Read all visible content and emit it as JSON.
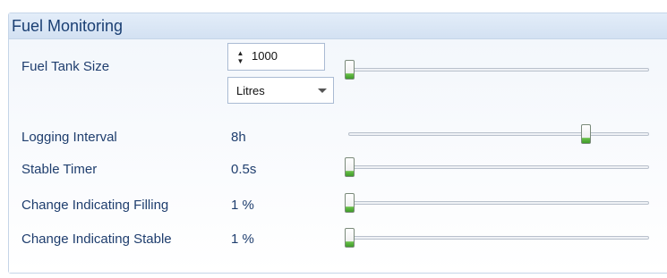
{
  "panel": {
    "title": "Fuel Monitoring"
  },
  "fields": {
    "fuel_tank_size": {
      "label": "Fuel Tank Size",
      "value": "1000",
      "unit": "Litres",
      "slider_fraction": 0.0
    },
    "logging_interval": {
      "label": "Logging Interval",
      "value": "8h",
      "slider_fraction": 0.8
    },
    "stable_timer": {
      "label": "Stable Timer",
      "value": "0.5s",
      "slider_fraction": 0.0
    },
    "change_filling": {
      "label": "Change Indicating Filling",
      "value": "1 %",
      "slider_fraction": 0.0
    },
    "change_stable": {
      "label": "Change Indicating Stable",
      "value": "1 %",
      "slider_fraction": 0.0
    }
  },
  "icons": {
    "spin": "spin-up-down-icon",
    "dropdown": "chevron-down-icon"
  },
  "colors": {
    "label_text": "#1f3e6e",
    "header_text": "#1a3f73",
    "thumb_green": "#4aa832"
  }
}
